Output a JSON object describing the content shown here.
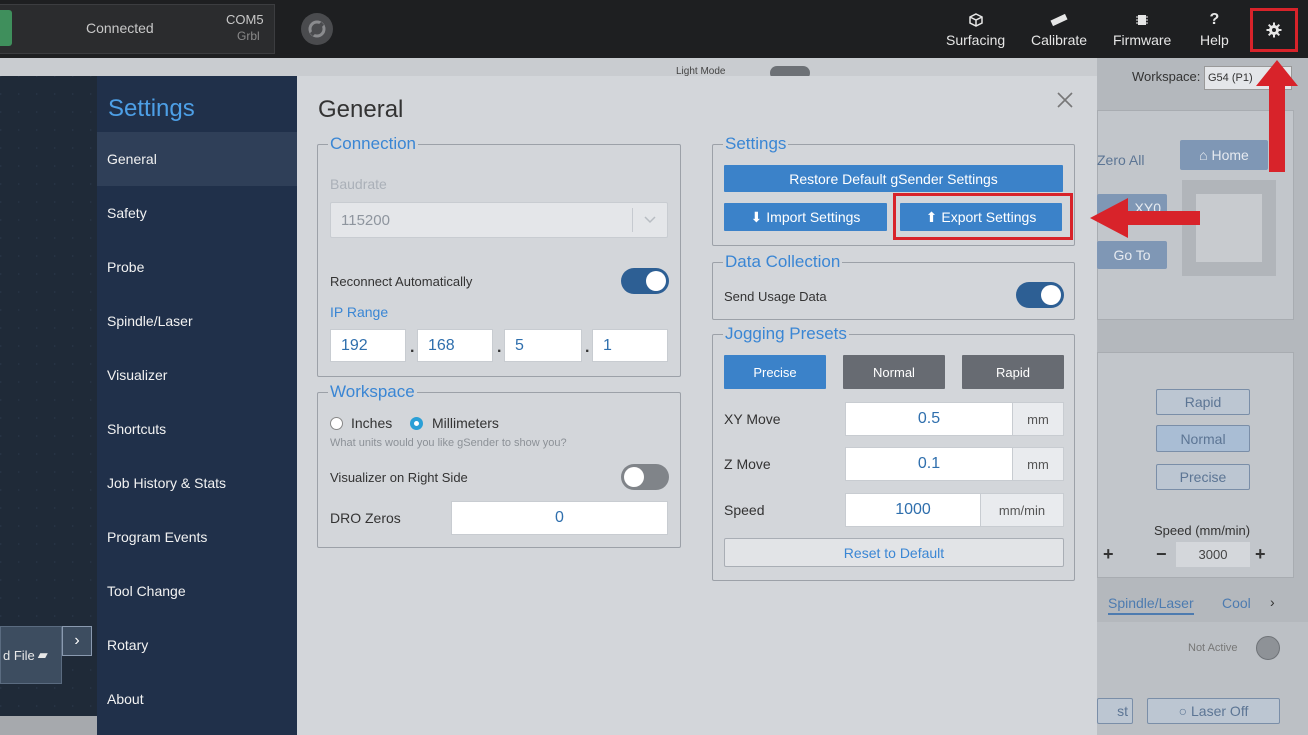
{
  "topbar": {
    "connection_status": "Connected",
    "port": "COM5",
    "firmware_type": "Grbl",
    "nav": [
      {
        "label": "Surfacing",
        "icon": "cube-icon"
      },
      {
        "label": "Calibrate",
        "icon": "ruler-icon"
      },
      {
        "label": "Firmware",
        "icon": "chip-icon"
      },
      {
        "label": "Help",
        "icon": "question-icon"
      }
    ],
    "settings_icon": "gear-icon"
  },
  "background": {
    "workspace_label": "Workspace:",
    "workspace_value": "G54 (P1)",
    "light_mode_label": "Light Mode",
    "zero_all": "Zero All",
    "home": "Home",
    "zero_xy": "XY0",
    "go_to": "Go To",
    "jog_rapid": "Rapid",
    "jog_normal": "Normal",
    "jog_precise": "Precise",
    "speed_label": "Speed (mm/min)",
    "speed_value": "3000",
    "tab_spindle": "Spindle/Laser",
    "tab_coolant": "Cool",
    "not_active": "Not Active",
    "laser_off": "Laser Off",
    "load_file": "d File",
    "test_label": "st"
  },
  "settings": {
    "title": "Settings",
    "nav_items": [
      "General",
      "Safety",
      "Probe",
      "Spindle/Laser",
      "Visualizer",
      "Shortcuts",
      "Job History & Stats",
      "Program Events",
      "Tool Change",
      "Rotary",
      "About"
    ],
    "active_item": "General",
    "page_title": "General",
    "connection": {
      "legend": "Connection",
      "baudrate_label": "Baudrate",
      "baudrate_value": "115200",
      "reconnect_label": "Reconnect Automatically",
      "reconnect_on": true,
      "ip_range_label": "IP Range",
      "ip": [
        "192",
        "168",
        "5",
        "1"
      ]
    },
    "workspace": {
      "legend": "Workspace",
      "inches": "Inches",
      "millimeters": "Millimeters",
      "selected_unit": "Millimeters",
      "units_hint": "What units would you like gSender to show you?",
      "visualizer_right_label": "Visualizer on Right Side",
      "visualizer_right_on": false,
      "dro_zeros_label": "DRO Zeros",
      "dro_zeros_value": "0"
    },
    "settings_group": {
      "legend": "Settings",
      "restore_default": "Restore Default gSender Settings",
      "import": "Import Settings",
      "export": "Export Settings"
    },
    "data_collection": {
      "legend": "Data Collection",
      "send_usage_label": "Send Usage Data",
      "send_usage_on": true
    },
    "jogging_presets": {
      "legend": "Jogging Presets",
      "presets": [
        "Precise",
        "Normal",
        "Rapid"
      ],
      "active_preset": "Precise",
      "xy_move_label": "XY Move",
      "xy_move_value": "0.5",
      "xy_unit": "mm",
      "z_move_label": "Z Move",
      "z_move_value": "0.1",
      "z_unit": "mm",
      "speed_label": "Speed",
      "speed_value": "1000",
      "speed_unit": "mm/min",
      "reset": "Reset to Default"
    }
  },
  "colors": {
    "accent": "#3b82c9",
    "sidebar": "#20304a",
    "highlight_annotation": "#d8232a"
  }
}
